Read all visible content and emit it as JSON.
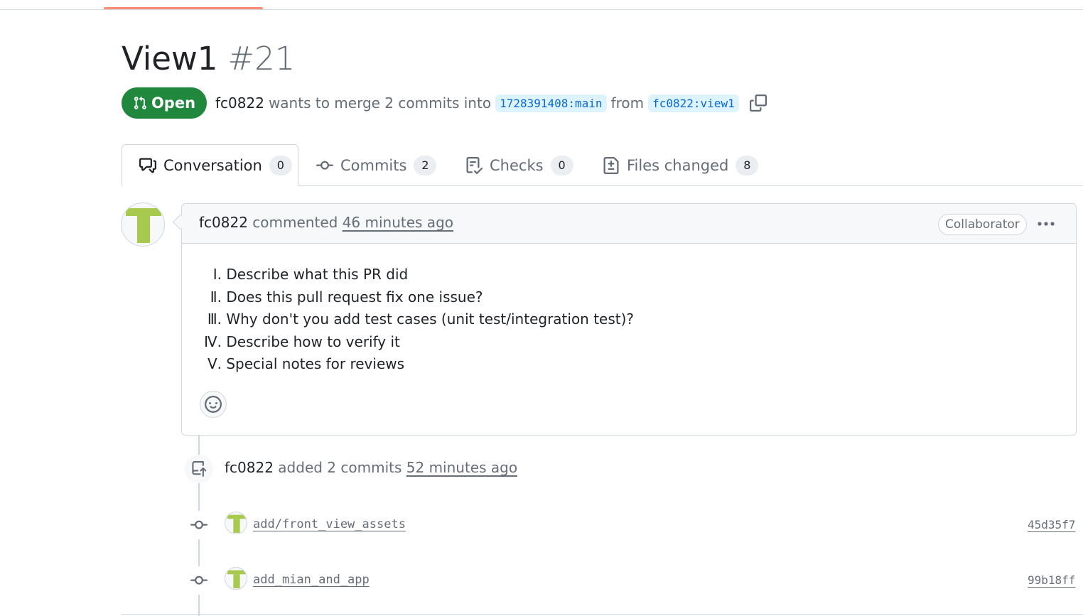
{
  "pr": {
    "title": "View1",
    "number": "#21",
    "state": "Open",
    "author": "fc0822",
    "merge_text": "wants to merge 2 commits into",
    "base_branch": "1728391408:main",
    "from_text": "from",
    "head_branch": "fc0822:view1"
  },
  "tabs": [
    {
      "label": "Conversation",
      "count": "0",
      "icon": "comment-discussion-icon"
    },
    {
      "label": "Commits",
      "count": "2",
      "icon": "git-commit-icon"
    },
    {
      "label": "Checks",
      "count": "0",
      "icon": "checklist-icon"
    },
    {
      "label": "Files changed",
      "count": "8",
      "icon": "file-diff-icon"
    }
  ],
  "comment": {
    "author": "fc0822",
    "action": "commented",
    "time": "46 minutes ago",
    "role": "Collaborator",
    "items": [
      {
        "mark": "Ⅰ.",
        "text": " Describe what this PR did"
      },
      {
        "mark": "Ⅱ.",
        "text": " Does this pull request fix one issue?"
      },
      {
        "mark": "Ⅲ.",
        "text": " Why don't you add test cases (unit test/integration test)?"
      },
      {
        "mark": "Ⅳ.",
        "text": " Describe how to verify it"
      },
      {
        "mark": "Ⅴ.",
        "text": " Special notes for reviews"
      }
    ]
  },
  "event": {
    "author": "fc0822",
    "action": "added 2 commits",
    "time": "52 minutes ago"
  },
  "commits": [
    {
      "message": "add/front_view_assets",
      "sha": "45d35f7"
    },
    {
      "message": "add_mian_and_app",
      "sha": "99b18ff"
    }
  ],
  "colors": {
    "open_green": "#1f883d",
    "link_blue": "#0969da",
    "branch_bg": "#ddf4ff",
    "tab_accent": "#fd8c73",
    "avatar_green": "#a6c94e"
  }
}
